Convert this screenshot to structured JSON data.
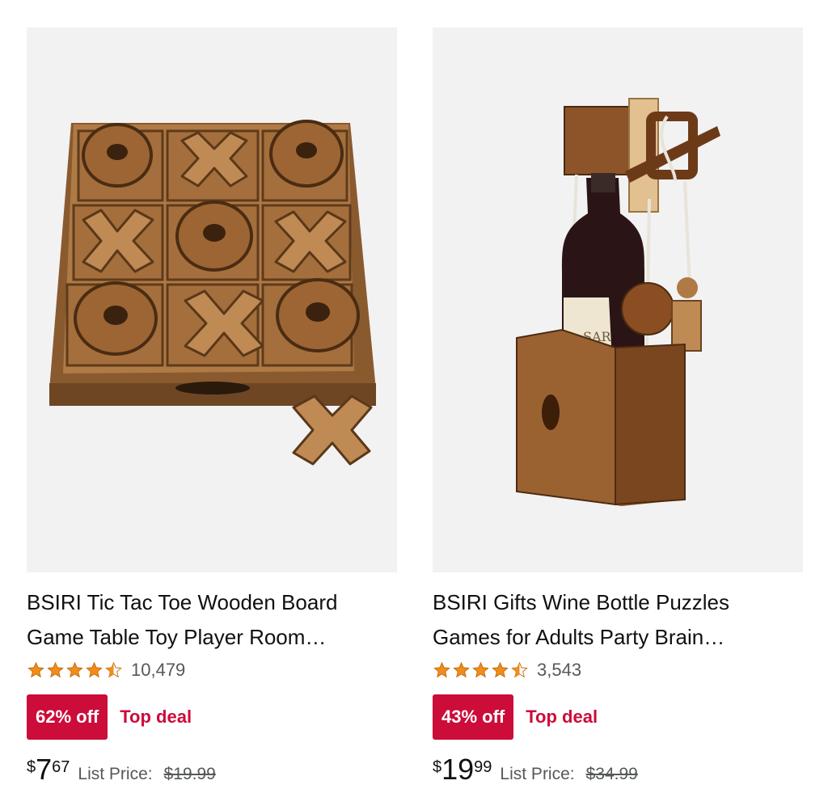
{
  "colors": {
    "deal_red": "#cc0c39",
    "star_orange": "#f28c1a",
    "image_bg": "#f2f2f3",
    "muted_text": "#565959"
  },
  "products": [
    {
      "image_icon": "tic-tac-toe-board-image",
      "title": "BSIRI Tic Tac Toe Wooden Board Game Table Toy Player Room…",
      "rating": 4.5,
      "rating_count": "10,479",
      "discount": "62% off",
      "deal_label": "Top deal",
      "price_currency": "$",
      "price_whole": "7",
      "price_fraction": "67",
      "list_price_label": "List Price:",
      "list_price": "$19.99"
    },
    {
      "image_icon": "wine-bottle-puzzle-image",
      "title": "BSIRI Gifts Wine Bottle Puzzles Games for Adults Party Brain…",
      "rating": 4.5,
      "rating_count": "3,543",
      "discount": "43% off",
      "deal_label": "Top deal",
      "price_currency": "$",
      "price_whole": "19",
      "price_fraction": "99",
      "list_price_label": "List Price:",
      "list_price": "$34.99"
    }
  ]
}
